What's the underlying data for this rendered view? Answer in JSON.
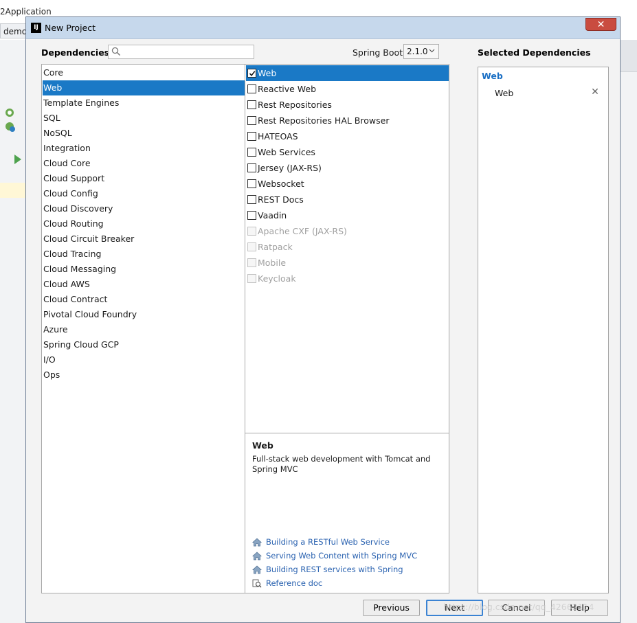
{
  "background": {
    "window_title": "2Application",
    "tab_label": "demo"
  },
  "dialog": {
    "title": "New Project",
    "app_icon_label": "IJ",
    "close_symbol": "✕"
  },
  "dependencies": {
    "label": "Dependencies",
    "search": {
      "value": "",
      "placeholder": ""
    },
    "spring_boot": {
      "label": "Spring Boot",
      "selected_version": "2.1.0"
    },
    "categories": [
      "Core",
      "Web",
      "Template Engines",
      "SQL",
      "NoSQL",
      "Integration",
      "Cloud Core",
      "Cloud Support",
      "Cloud Config",
      "Cloud Discovery",
      "Cloud Routing",
      "Cloud Circuit Breaker",
      "Cloud Tracing",
      "Cloud Messaging",
      "Cloud AWS",
      "Cloud Contract",
      "Pivotal Cloud Foundry",
      "Azure",
      "Spring Cloud GCP",
      "I/O",
      "Ops"
    ],
    "selected_category": "Web",
    "items": [
      {
        "label": "Web",
        "checked": true,
        "enabled": true,
        "selected": true
      },
      {
        "label": "Reactive Web",
        "checked": false,
        "enabled": true
      },
      {
        "label": "Rest Repositories",
        "checked": false,
        "enabled": true
      },
      {
        "label": "Rest Repositories HAL Browser",
        "checked": false,
        "enabled": true
      },
      {
        "label": "HATEOAS",
        "checked": false,
        "enabled": true
      },
      {
        "label": "Web Services",
        "checked": false,
        "enabled": true
      },
      {
        "label": "Jersey (JAX-RS)",
        "checked": false,
        "enabled": true
      },
      {
        "label": "Websocket",
        "checked": false,
        "enabled": true
      },
      {
        "label": "REST Docs",
        "checked": false,
        "enabled": true
      },
      {
        "label": "Vaadin",
        "checked": false,
        "enabled": true
      },
      {
        "label": "Apache CXF (JAX-RS)",
        "checked": false,
        "enabled": false
      },
      {
        "label": "Ratpack",
        "checked": false,
        "enabled": false
      },
      {
        "label": "Mobile",
        "checked": false,
        "enabled": false
      },
      {
        "label": "Keycloak",
        "checked": false,
        "enabled": false
      }
    ],
    "description": {
      "title": "Web",
      "text": "Full-stack web development with Tomcat and Spring MVC",
      "links": [
        {
          "label": "Building a RESTful Web Service",
          "icon": "home-icon"
        },
        {
          "label": "Serving Web Content with Spring MVC",
          "icon": "home-icon"
        },
        {
          "label": "Building REST services with Spring",
          "icon": "home-icon"
        },
        {
          "label": "Reference doc",
          "icon": "doc-search-icon"
        }
      ]
    }
  },
  "selected_dependencies": {
    "label": "Selected Dependencies",
    "group": "Web",
    "items": [
      {
        "label": "Web",
        "remove_symbol": "✕"
      }
    ]
  },
  "buttons": {
    "previous": "Previous",
    "next": "Next",
    "cancel": "Cancel",
    "help": "Help"
  },
  "watermark": "https://blog.csdn.net/qq_42662114",
  "colors": {
    "selection": "#1a79c6",
    "link": "#2a62b0",
    "group_heading": "#1a6fc4",
    "titlebar": "#c6d8ec",
    "close_button": "#c94c40"
  }
}
